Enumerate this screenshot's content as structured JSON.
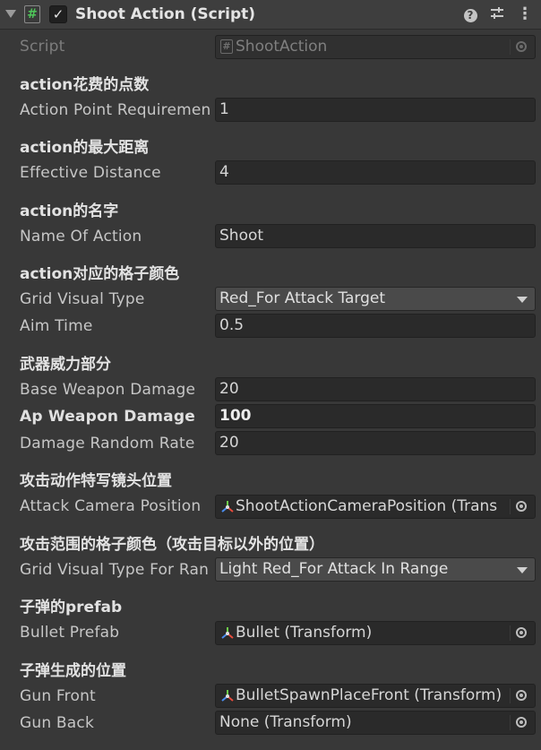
{
  "header": {
    "title": "Shoot Action (Script)",
    "enabled": true,
    "icons": [
      "script-icon",
      "help-icon",
      "preset-icon",
      "menu-icon"
    ]
  },
  "script": {
    "label": "Script",
    "value": "ShootAction"
  },
  "sections": {
    "s1": "action花费的点数",
    "s2": "action的最大距离",
    "s3": "action的名字",
    "s4": "action对应的格子颜色",
    "s5": "武器威力部分",
    "s6": "攻击动作特写镜头位置",
    "s7": "攻击范围的格子颜色（攻击目标以外的位置）",
    "s8": "子弹的prefab",
    "s9": "子弹生成的位置"
  },
  "fields": {
    "action_point": {
      "label": "Action Point Requiremen",
      "value": "1"
    },
    "effective_distance": {
      "label": "Effective Distance",
      "value": "4"
    },
    "name_of_action": {
      "label": "Name Of Action",
      "value": "Shoot"
    },
    "grid_visual_type": {
      "label": "Grid Visual Type",
      "value": "Red_For Attack Target"
    },
    "aim_time": {
      "label": "Aim Time",
      "value": "0.5"
    },
    "base_weapon_damage": {
      "label": "Base Weapon Damage",
      "value": "20"
    },
    "ap_weapon_damage": {
      "label": "Ap Weapon Damage",
      "value": "100"
    },
    "damage_random_rate": {
      "label": "Damage Random Rate",
      "value": "20"
    },
    "attack_camera_position": {
      "label": "Attack Camera Position",
      "value": "ShootActionCameraPosition (Trans"
    },
    "grid_visual_type_range": {
      "label": "Grid Visual Type For Ran",
      "value": "Light Red_For Attack In Range"
    },
    "bullet_prefab": {
      "label": "Bullet Prefab",
      "value": "Bullet (Transform)"
    },
    "gun_front": {
      "label": "Gun Front",
      "value": "BulletSpawnPlaceFront (Transform)"
    },
    "gun_back": {
      "label": "Gun Back",
      "value": "None (Transform)"
    }
  },
  "colors": {
    "background": "#383838",
    "field": "#2a2a2a",
    "dropdown": "#4a4a4a",
    "script_icon": "#4fc65a"
  }
}
